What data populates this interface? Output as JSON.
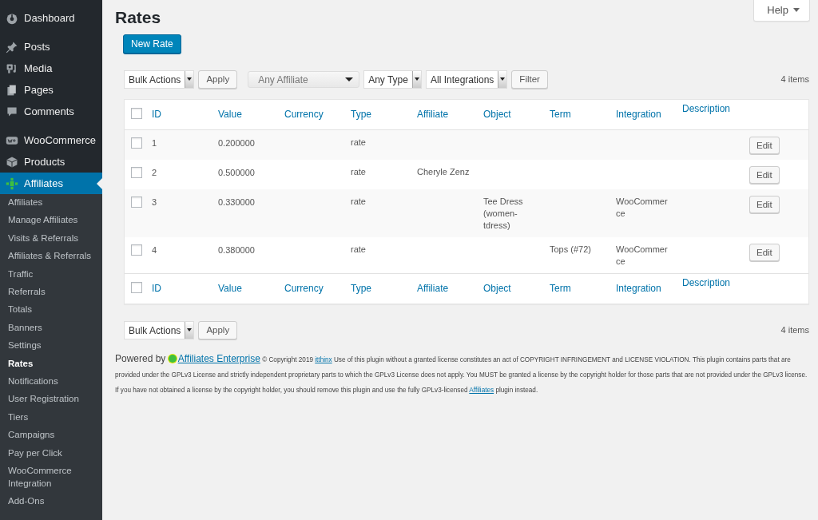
{
  "sidebar": {
    "groups": [
      [
        {
          "label": "Dashboard",
          "selected": false
        }
      ],
      [
        {
          "label": "Posts",
          "selected": false
        },
        {
          "label": "Media",
          "selected": false
        },
        {
          "label": "Pages",
          "selected": false
        },
        {
          "label": "Comments",
          "selected": false
        }
      ],
      [
        {
          "label": "WooCommerce",
          "selected": false
        },
        {
          "label": "Products",
          "selected": false
        },
        {
          "label": "Affiliates",
          "selected": true
        }
      ]
    ],
    "submenu": [
      {
        "label": "Affiliates",
        "selected": false
      },
      {
        "label": "Manage Affiliates",
        "selected": false
      },
      {
        "label": "Visits & Referrals",
        "selected": false
      },
      {
        "label": "Affiliates & Referrals",
        "selected": false
      },
      {
        "label": "Traffic",
        "selected": false
      },
      {
        "label": "Referrals",
        "selected": false
      },
      {
        "label": "Totals",
        "selected": false
      },
      {
        "label": "Banners",
        "selected": false
      },
      {
        "label": "Settings",
        "selected": false
      },
      {
        "label": "Rates",
        "selected": true
      },
      {
        "label": "Notifications",
        "selected": false
      },
      {
        "label": "User Registration",
        "selected": false
      },
      {
        "label": "Tiers",
        "selected": false
      },
      {
        "label": "Campaigns",
        "selected": false
      },
      {
        "label": "Pay per Click",
        "selected": false
      },
      {
        "label": "WooCommerce Integration",
        "selected": false
      },
      {
        "label": "Add-Ons",
        "selected": false
      }
    ]
  },
  "help_button": "Help",
  "page_title": "Rates",
  "new_button": "New Rate",
  "top_toolbar": {
    "bulk_actions": "Bulk Actions",
    "apply": "Apply",
    "filters": [
      {
        "kind": "combo",
        "value": "Any Affiliate"
      },
      {
        "kind": "select",
        "value": "Any Type"
      },
      {
        "kind": "select",
        "value": "All Integrations"
      }
    ],
    "filter_button": "Filter",
    "count": "4 items"
  },
  "table": {
    "columns": [
      "ID",
      "Value",
      "Currency",
      "Type",
      "Affiliate",
      "Object",
      "Term",
      "Integration",
      "Description"
    ],
    "rows": [
      {
        "checked": false,
        "cells": [
          "1",
          "0.200000",
          "",
          "rate",
          "",
          "",
          "",
          "",
          ""
        ],
        "action": "Edit"
      },
      {
        "checked": false,
        "cells": [
          "2",
          "0.500000",
          "",
          "rate",
          "Cheryle Zenz",
          "",
          "",
          "",
          ""
        ],
        "action": "Edit"
      },
      {
        "checked": false,
        "cells": [
          "3",
          "0.330000",
          "",
          "rate",
          "",
          "Tee Dress (women-tdress)",
          "",
          "WooCommerce",
          ""
        ],
        "action": "Edit"
      },
      {
        "checked": false,
        "cells": [
          "4",
          "0.380000",
          "",
          "rate",
          "",
          "",
          "Tops (#72)",
          "WooCommerce",
          ""
        ],
        "action": "Edit"
      }
    ],
    "footer_columns": [
      "ID",
      "Value",
      "Currency",
      "Type",
      "Affiliate",
      "Object",
      "Term",
      "Integration",
      "Description"
    ],
    "header_checked": false,
    "footer_checked": false
  },
  "bottom_toolbar": {
    "bulk_actions": "Bulk Actions",
    "apply": "Apply",
    "count": "4 items"
  },
  "footer": {
    "powered_by": "Powered by",
    "brand_link": "Affiliates Enterprise",
    "copyright": "© Copyright 2019",
    "author_link": "itthinx",
    "notice": "Use of this plugin without a granted license constitutes an act of COPYRIGHT INFRINGEMENT and LICENSE VIOLATION. This plugin contains parts that are provided under the GPLv3 License and strictly independent proprietary parts to which the GPLv3 License does not apply. You MUST be granted a license by the copyright holder for those parts that are not provided under the GPLv3 license. If you have not obtained a license by the copyright holder, you should remove this plugin and use the fully GPLv3-licensed",
    "plugin_link": "Affiliates",
    "notice_end": "plugin instead."
  }
}
